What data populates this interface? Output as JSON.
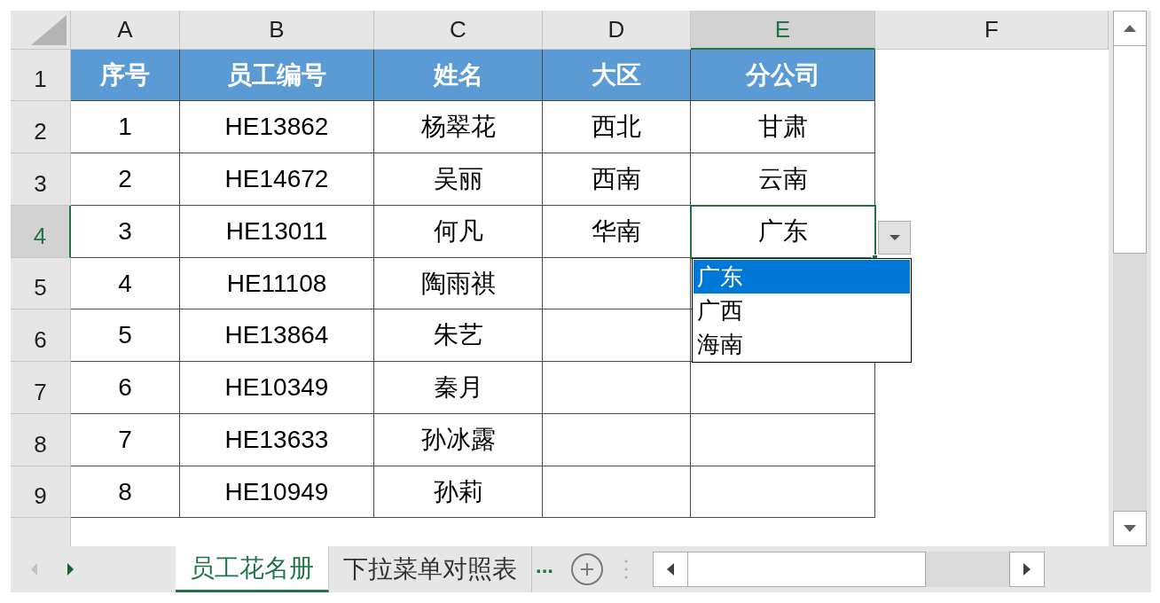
{
  "columns": [
    {
      "letter": "A",
      "selected": false
    },
    {
      "letter": "B",
      "selected": false
    },
    {
      "letter": "C",
      "selected": false
    },
    {
      "letter": "D",
      "selected": false
    },
    {
      "letter": "E",
      "selected": true
    },
    {
      "letter": "F",
      "selected": false
    }
  ],
  "rows": [
    {
      "number": "1",
      "kind": "header",
      "selected": false,
      "cells": [
        "序号",
        "员工编号",
        "姓名",
        "大区",
        "分公司"
      ]
    },
    {
      "number": "2",
      "kind": "data",
      "selected": false,
      "cells": [
        "1",
        "HE13862",
        "杨翠花",
        "西北",
        "甘肃"
      ]
    },
    {
      "number": "3",
      "kind": "data",
      "selected": false,
      "cells": [
        "2",
        "HE14672",
        "吴丽",
        "西南",
        "云南"
      ]
    },
    {
      "number": "4",
      "kind": "data",
      "selected": true,
      "cells": [
        "3",
        "HE13011",
        "何凡",
        "华南",
        "广东"
      ]
    },
    {
      "number": "5",
      "kind": "data",
      "selected": false,
      "cells": [
        "4",
        "HE11108",
        "陶雨祺"
      ]
    },
    {
      "number": "6",
      "kind": "data",
      "selected": false,
      "cells": [
        "5",
        "HE13864",
        "朱艺"
      ]
    },
    {
      "number": "7",
      "kind": "data",
      "selected": false,
      "cells": [
        "6",
        "HE10349",
        "秦月"
      ]
    },
    {
      "number": "8",
      "kind": "data",
      "selected": false,
      "cells": [
        "7",
        "HE13633",
        "孙冰露"
      ]
    },
    {
      "number": "9",
      "kind": "data",
      "selected": false,
      "cells": [
        "8",
        "HE10949",
        "孙莉"
      ]
    }
  ],
  "dropdown": {
    "options": [
      {
        "label": "广东",
        "selected": true
      },
      {
        "label": "广西",
        "selected": false
      },
      {
        "label": "海南",
        "selected": false
      }
    ]
  },
  "sheet_tabs": [
    {
      "label": "员工花名册",
      "selected": true
    },
    {
      "label": "下拉菜单对照表",
      "selected": false
    }
  ],
  "more_tabs": "..."
}
